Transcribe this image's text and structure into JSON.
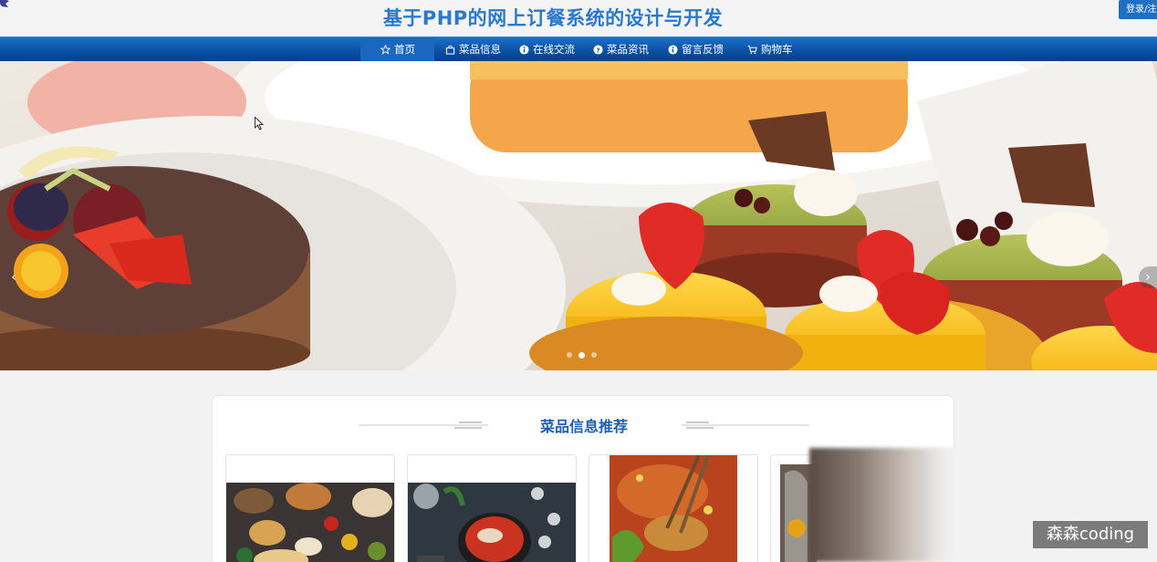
{
  "header": {
    "title": "基于PHP的网上订餐系统的设计与开发",
    "login_label": "登录/注册"
  },
  "nav": {
    "items": [
      {
        "label": "首页",
        "icon": "star-icon",
        "active": true
      },
      {
        "label": "菜品信息",
        "icon": "bag-icon",
        "active": false
      },
      {
        "label": "在线交流",
        "icon": "info-icon",
        "active": false
      },
      {
        "label": "菜品资讯",
        "icon": "question-icon",
        "active": false
      },
      {
        "label": "留言反馈",
        "icon": "info-icon",
        "active": false
      },
      {
        "label": "购物车",
        "icon": "cart-icon",
        "active": false
      }
    ]
  },
  "banner": {
    "slides": 3,
    "active_slide": 2,
    "prev_label": "‹",
    "next_label": "›"
  },
  "recommend": {
    "title": "菜品信息推荐"
  },
  "watermark": "森森coding",
  "colors": {
    "brand_blue": "#1b5eb3",
    "nav_blue": "#0a4fa2",
    "title_blue": "#2b78cf"
  }
}
